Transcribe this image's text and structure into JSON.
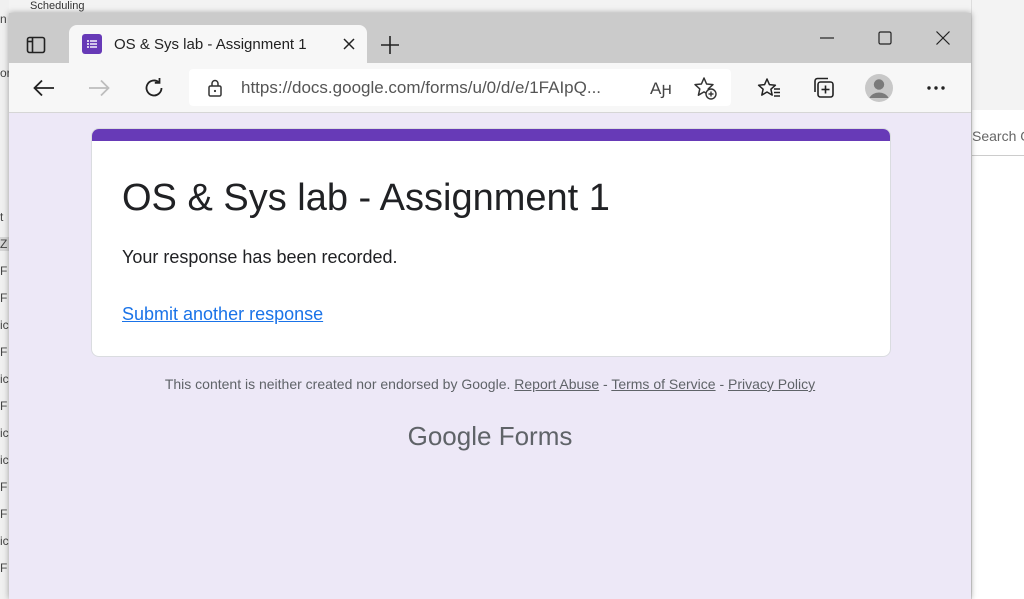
{
  "background": {
    "top_text": "Scheduling",
    "left_glyphs": [
      "n",
      "or",
      "t",
      "Z",
      "F",
      "F",
      "ic",
      "F",
      "ic",
      "F",
      "ic",
      "ic",
      "F",
      "F",
      "ic",
      "F"
    ],
    "right_search_text": "Search Os"
  },
  "browser": {
    "tab": {
      "title": "OS & Sys lab - Assignment 1"
    },
    "address_bar": {
      "url": "https://docs.google.com/forms/u/0/d/e/1FAIpQ..."
    },
    "read_aloud_label": "Aԩ"
  },
  "page": {
    "accent_color": "#673ab7",
    "form_title": "OS & Sys lab - Assignment 1",
    "confirmation_message": "Your response has been recorded.",
    "submit_another_label": "Submit another response",
    "footer": {
      "disclaimer_text": "This content is neither created nor endorsed by Google.",
      "report_abuse": "Report Abuse",
      "separator": " - ",
      "terms_of_service": "Terms of Service",
      "privacy_policy": "Privacy Policy"
    },
    "logo": {
      "google": "Google",
      "forms": "Forms"
    }
  }
}
